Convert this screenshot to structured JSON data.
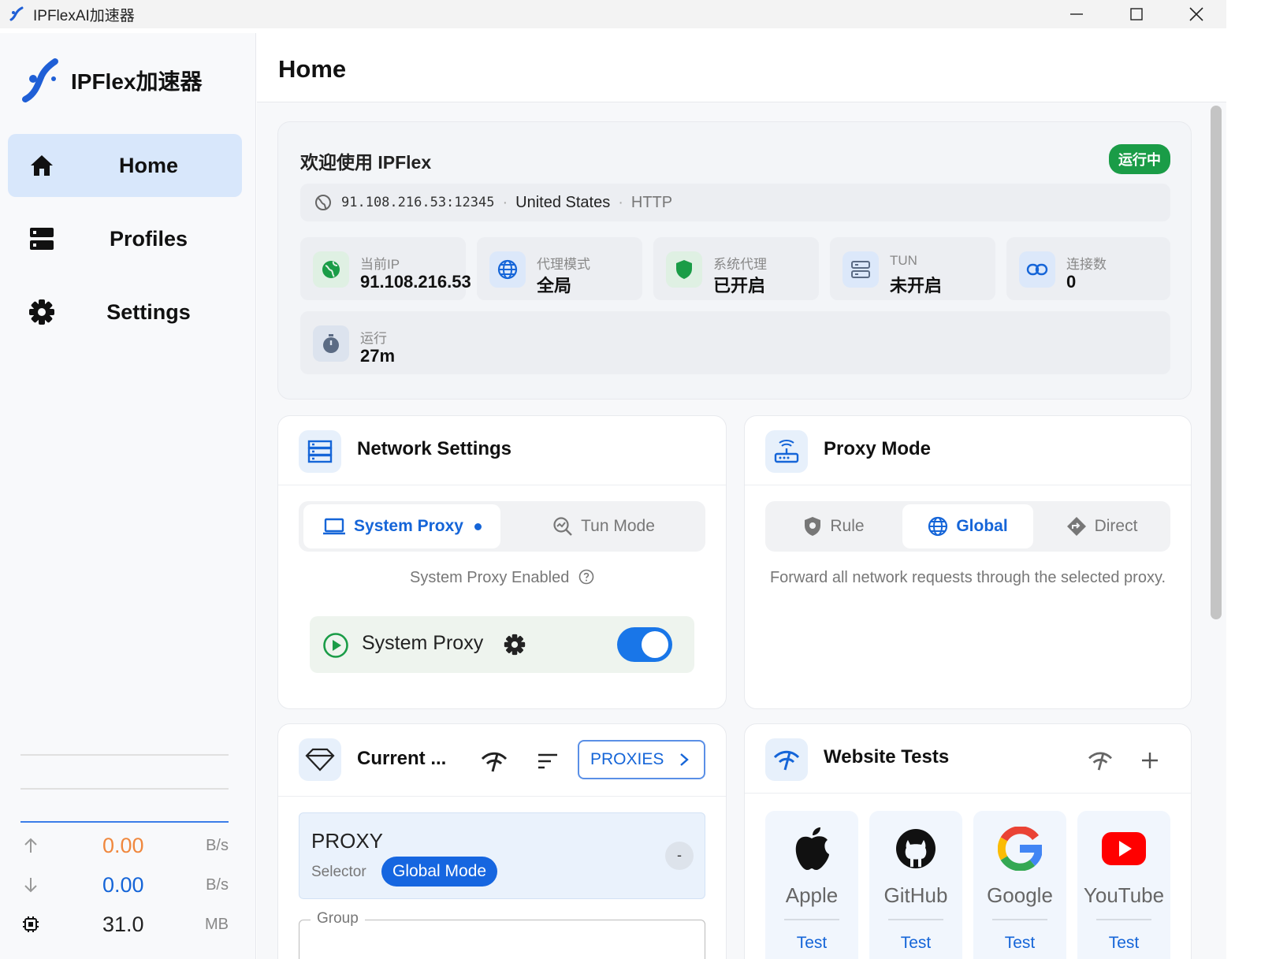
{
  "window": {
    "title": "IPFlexAI加速器"
  },
  "sidebar": {
    "brand": "IPFlex加速器",
    "items": [
      {
        "label": "Home",
        "icon": "home-icon",
        "active": true
      },
      {
        "label": "Profiles",
        "icon": "profiles-icon"
      },
      {
        "label": "Settings",
        "icon": "gear-icon"
      }
    ],
    "traffic": {
      "up": {
        "value": "0.00",
        "unit": "B/s",
        "color": "#f0883e"
      },
      "down": {
        "value": "0.00",
        "unit": "B/s",
        "color": "#1565d8"
      },
      "memory": {
        "value": "31.0",
        "unit": "MB"
      }
    }
  },
  "main": {
    "title": "Home",
    "welcome": {
      "title": "欢迎使用 IPFlex",
      "status": "运行中",
      "ip": "91.108.216.53:12345",
      "country": "United States",
      "protocol": "HTTP",
      "tiles": [
        {
          "label": "当前IP",
          "value": "91.108.216.53",
          "icon": "globe-icon"
        },
        {
          "label": "代理模式",
          "value": "全局",
          "icon": "web-icon"
        },
        {
          "label": "系统代理",
          "value": "已开启",
          "icon": "shield-icon"
        },
        {
          "label": "TUN",
          "value": "未开启",
          "icon": "server-icon"
        },
        {
          "label": "连接数",
          "value": "0",
          "icon": "link-icon"
        },
        {
          "label": "运行",
          "value": "27m",
          "icon": "timer-icon"
        }
      ]
    },
    "network": {
      "title": "Network Settings",
      "options": [
        "System Proxy",
        "Tun Mode"
      ],
      "selected": "System Proxy",
      "hint": "System Proxy Enabled",
      "row_label": "System Proxy",
      "toggle_on": true
    },
    "proxy_mode": {
      "title": "Proxy Mode",
      "options": [
        "Rule",
        "Global",
        "Direct"
      ],
      "selected": "Global",
      "description": "Forward all network requests through the selected proxy."
    },
    "current": {
      "title": "Current ...",
      "button": "PROXIES",
      "proxy_name": "PROXY",
      "proxy_type": "Selector",
      "mode_badge": "Global Mode",
      "proxy_action": "-",
      "group_label": "Group"
    },
    "website_tests": {
      "title": "Website Tests",
      "sites": [
        {
          "name": "Apple",
          "action": "Test"
        },
        {
          "name": "GitHub",
          "action": "Test"
        },
        {
          "name": "Google",
          "action": "Test"
        },
        {
          "name": "YouTube",
          "action": "Test"
        }
      ]
    }
  }
}
